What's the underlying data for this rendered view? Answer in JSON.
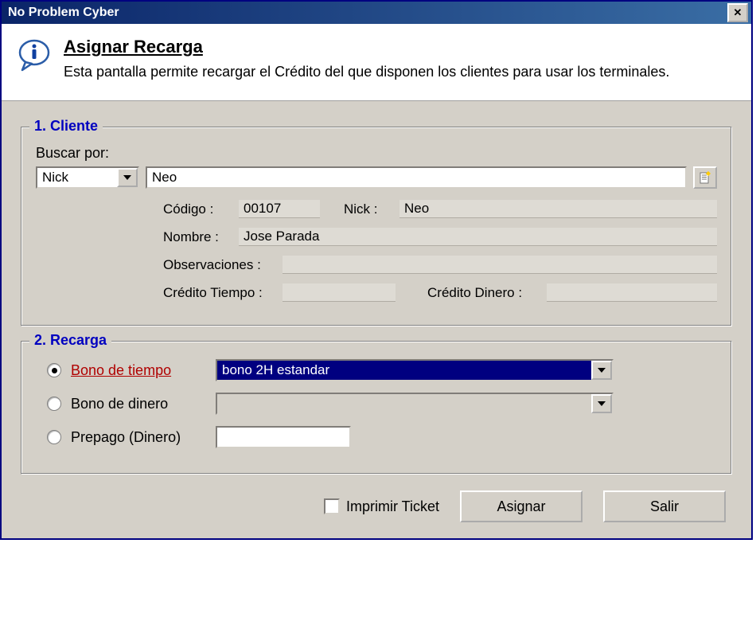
{
  "window": {
    "title": "No Problem Cyber"
  },
  "header": {
    "heading": "Asignar Recarga",
    "description": "Esta pantalla permite recargar el Crédito del que disponen los clientes para usar los terminales."
  },
  "cliente": {
    "legend": "1. Cliente",
    "search_label": "Buscar por:",
    "search_by_selected": "Nick",
    "search_value": "Neo",
    "fields": {
      "codigo_label": "Código :",
      "codigo_value": "00107",
      "nick_label": "Nick :",
      "nick_value": "Neo",
      "nombre_label": "Nombre :",
      "nombre_value": "Jose Parada",
      "observ_label": "Observaciones :",
      "observ_value": "",
      "credtiempo_label": "Crédito Tiempo :",
      "credtiempo_value": "",
      "creddinero_label": "Crédito Dinero :",
      "creddinero_value": ""
    }
  },
  "recarga": {
    "legend": "2. Recarga",
    "options": {
      "bono_tiempo": {
        "label": "Bono de tiempo",
        "selected": "bono 2H estandar",
        "checked": true
      },
      "bono_dinero": {
        "label": "Bono de dinero",
        "selected": "",
        "checked": false
      },
      "prepago": {
        "label": "Prepago (Dinero)",
        "value": "",
        "checked": false
      }
    }
  },
  "footer": {
    "print_label": "Imprimir Ticket",
    "print_checked": false,
    "assign_label": "Asignar",
    "exit_label": "Salir"
  }
}
